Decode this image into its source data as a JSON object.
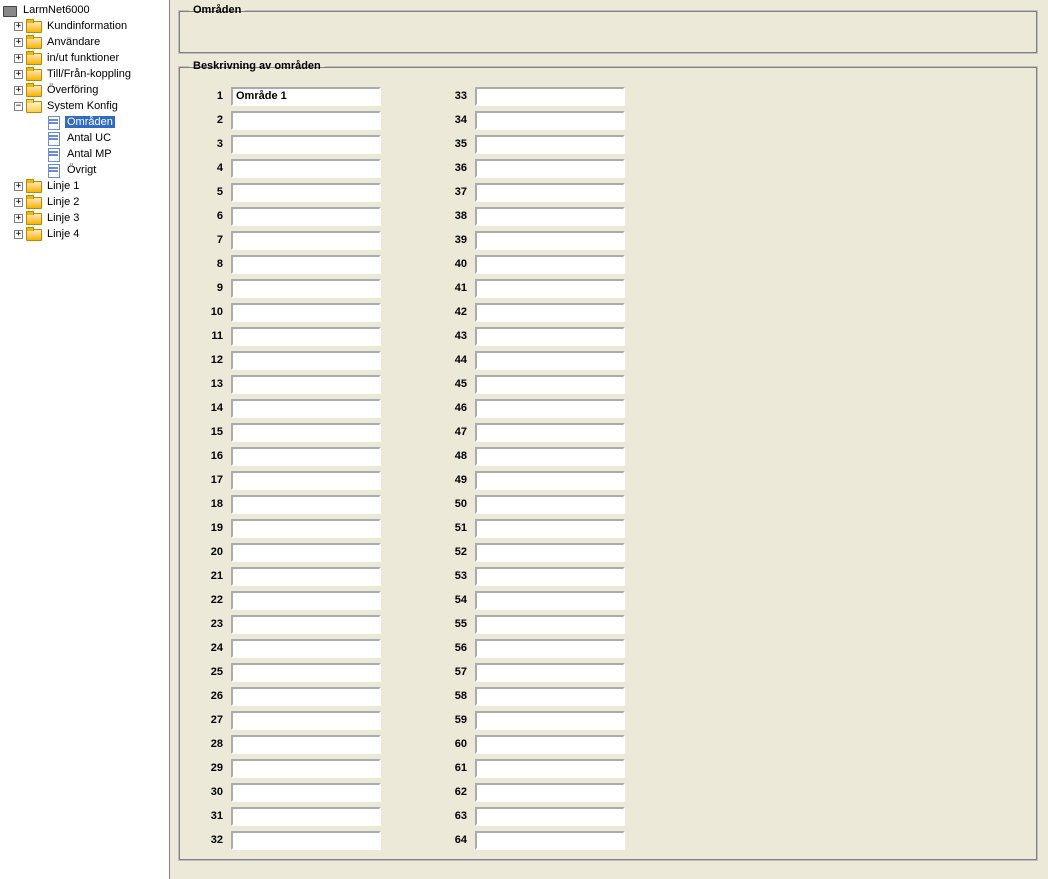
{
  "tree": {
    "root": "LarmNet6000",
    "items": [
      {
        "label": "Kundinformation",
        "expandable": true,
        "expanded": false,
        "level": 1,
        "icon": "folder"
      },
      {
        "label": "Användare",
        "expandable": true,
        "expanded": false,
        "level": 1,
        "icon": "folder"
      },
      {
        "label": "in/ut funktioner",
        "expandable": true,
        "expanded": false,
        "level": 1,
        "icon": "folder"
      },
      {
        "label": "Till/Från-koppling",
        "expandable": true,
        "expanded": false,
        "level": 1,
        "icon": "folder"
      },
      {
        "label": "Överföring",
        "expandable": true,
        "expanded": false,
        "level": 1,
        "icon": "folder"
      },
      {
        "label": "System Konfig",
        "expandable": true,
        "expanded": true,
        "level": 1,
        "icon": "open-folder"
      },
      {
        "label": "Områden",
        "expandable": false,
        "expanded": false,
        "level": 2,
        "icon": "page",
        "selected": true
      },
      {
        "label": "Antal UC",
        "expandable": false,
        "expanded": false,
        "level": 2,
        "icon": "page"
      },
      {
        "label": "Antal MP",
        "expandable": false,
        "expanded": false,
        "level": 2,
        "icon": "page"
      },
      {
        "label": "Övrigt",
        "expandable": false,
        "expanded": false,
        "level": 2,
        "icon": "page"
      },
      {
        "label": "Linje 1",
        "expandable": true,
        "expanded": false,
        "level": 1,
        "icon": "folder"
      },
      {
        "label": "Linje 2",
        "expandable": true,
        "expanded": false,
        "level": 1,
        "icon": "folder"
      },
      {
        "label": "Linje 3",
        "expandable": true,
        "expanded": false,
        "level": 1,
        "icon": "folder"
      },
      {
        "label": "Linje 4",
        "expandable": true,
        "expanded": false,
        "level": 1,
        "icon": "folder"
      }
    ]
  },
  "panel": {
    "group1_title": "Områden",
    "group2_title": "Beskrivning av områden"
  },
  "areas": {
    "count": 64,
    "values": {
      "1": "Område 1"
    }
  }
}
